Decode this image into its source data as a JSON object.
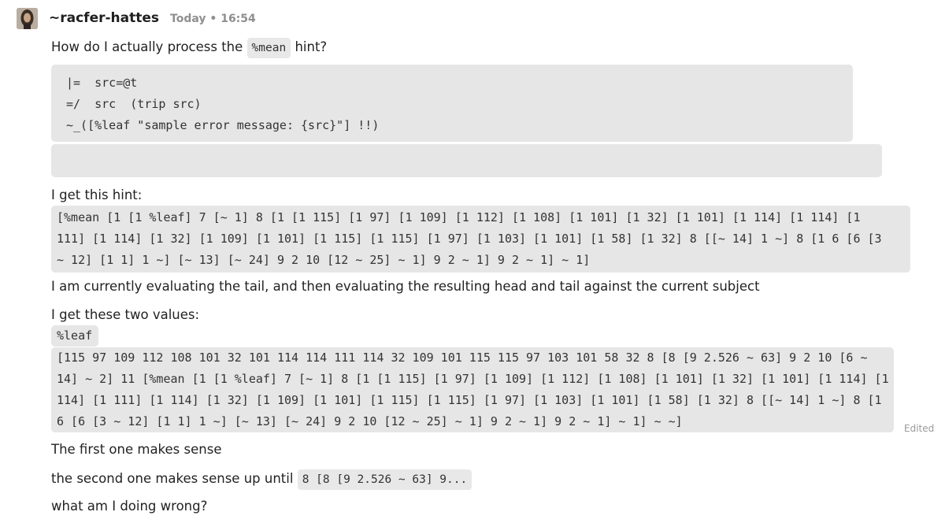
{
  "message": {
    "author": "~racfer-hattes",
    "timestamp": "Today • 16:54",
    "edited_label": "Edited",
    "question_prefix": "How do I actually process the",
    "question_code": "%mean",
    "question_suffix": "hint?",
    "code_lines": [
      "|=  src=@t",
      "=/  src  (trip src)",
      "~_([%leaf \"sample error message: {src}\"] !!)"
    ],
    "hint_intro": "I get this hint:",
    "hint_code": "[%mean [1 [1 %leaf] 7 [~ 1] 8 [1 [1 115] [1 97] [1 109] [1 112] [1 108] [1 101] [1 32] [1 101] [1 114] [1 114] [1 111] [1 114] [1 32] [1 109] [1 101] [1 115] [1 115] [1 97] [1 103] [1 101] [1 58] [1 32] 8 [[~ 14] 1 ~] 8 [1 6 [6 [3 ~ 12] [1 1] 1 ~] [~ 13] [~ 24] 9 2 10 [12 ~ 25] ~ 1] 9 2 ~ 1] 9 2 ~ 1] ~ 1]",
    "eval_text": "I am currently evaluating the tail, and then evaluating the resulting head and tail against the current subject",
    "values_intro": "I get these two values:",
    "value1": "%leaf",
    "value2": "[115 97 109 112 108 101 32 101 114 114 111 114 32 109 101 115 115 97 103 101 58 32 8 [8 [9 2.526 ~ 63] 9 2 10 [6 ~ 14] ~ 2] 11 [%mean [1 [1 %leaf] 7 [~ 1] 8 [1 [1 115] [1 97] [1 109] [1 112] [1 108] [1 101] [1 32] [1 101] [1 114] [1 114] [1 111] [1 114] [1 32] [1 109] [1 101] [1 115] [1 115] [1 97] [1 103] [1 101] [1 58] [1 32] 8 [[~ 14] 1 ~] 8 [1 6 [6 [3 ~ 12] [1 1] 1 ~] [~ 13] [~ 24] 9 2 10 [12 ~ 25] ~ 1] 9 2 ~ 1] 9 2 ~ 1] ~ 1] ~ ~]",
    "first_sense": "The first one makes sense",
    "second_prefix": "the second one makes sense up until",
    "second_code": "8 [8 [9 2.526 ~ 63] 9...",
    "closing": "what am I doing wrong?"
  }
}
